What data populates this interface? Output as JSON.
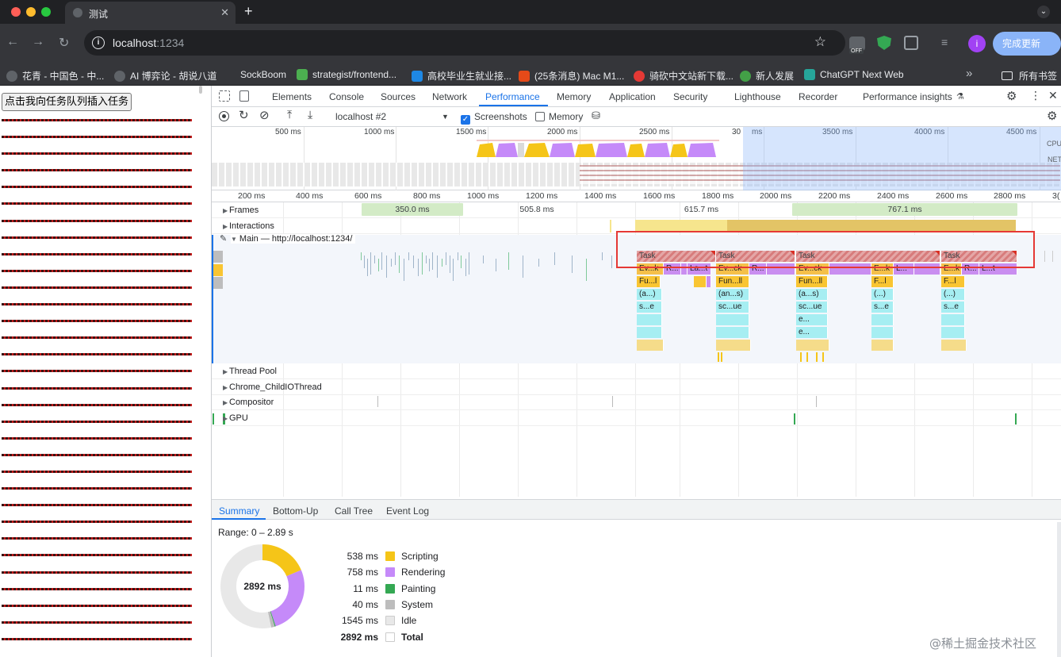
{
  "browser": {
    "tab_title": "测试",
    "url_host": "localhost",
    "url_port": ":1234",
    "update_button": "完成更新",
    "avatar_letter": "i",
    "off_badge": "OFF"
  },
  "bookmarks": [
    {
      "label": "花青 - 中国色 - 中...",
      "color": "#5f6368"
    },
    {
      "label": "AI 博弈论 - 胡说八道",
      "color": "#5f6368"
    },
    {
      "label": "SockBoom",
      "color": "#35363a"
    },
    {
      "label": "strategist/frontend...",
      "color": "#4caf50"
    },
    {
      "label": "高校毕业生就业接...",
      "color": "#1e88e5"
    },
    {
      "label": "(25条消息) Mac M1...",
      "color": "#e64a19"
    },
    {
      "label": "骑砍中文站新下载...",
      "color": "#e53935"
    },
    {
      "label": "新人发展",
      "color": "#43a047"
    },
    {
      "label": "ChatGPT Next Web",
      "color": "#26a69a"
    }
  ],
  "bookmarks_all": "所有书签",
  "page": {
    "insert_button": "点击我向任务队列插入任务"
  },
  "devtools": {
    "tabs": [
      "Elements",
      "Console",
      "Sources",
      "Network",
      "Performance",
      "Memory",
      "Application",
      "Security",
      "Lighthouse",
      "Recorder",
      "Performance insights"
    ],
    "active_tab": "Performance",
    "recording_select": "localhost #2",
    "screenshots_label": "Screenshots",
    "screenshots_checked": true,
    "memory_label": "Memory",
    "memory_checked": false,
    "overview_ticks": [
      "500 ms",
      "1000 ms",
      "1500 ms",
      "2000 ms",
      "2500 ms",
      "30",
      "ms",
      "3500 ms",
      "4000 ms",
      "4500 ms"
    ],
    "overview_cpu": "CPU",
    "overview_net": "NET",
    "ruler_ticks": [
      "200 ms",
      "400 ms",
      "600 ms",
      "800 ms",
      "1000 ms",
      "1200 ms",
      "1400 ms",
      "1600 ms",
      "1800 ms",
      "2000 ms",
      "2200 ms",
      "2400 ms",
      "2600 ms",
      "2800 ms",
      "3("
    ],
    "tracks": {
      "frames": "Frames",
      "frame_values": [
        "350.0 ms",
        "505.8 ms",
        "615.7 ms",
        "767.1 ms"
      ],
      "interactions": "Interactions",
      "main": "Main — http://localhost:1234/",
      "thread_pool": "Thread Pool",
      "io_thread": "Chrome_ChildIOThread",
      "compositor": "Compositor",
      "gpu": "GPU"
    },
    "flame": {
      "task": "Task",
      "row2": [
        "Ev...k",
        "R...",
        "La...t",
        "Ev...ck",
        "R...",
        "Ev...ck",
        "E...k",
        "L...",
        "E...k",
        "R...",
        "L...t"
      ],
      "row3": [
        "Fu...l",
        "Fun...ll",
        "Fun...ll",
        "F...l",
        "F...l"
      ],
      "row4": [
        "(a...)",
        "(an...s)",
        "(a...s)",
        "(...)",
        "(...)"
      ],
      "row5": [
        "s...e",
        "sc...ue",
        "sc...ue",
        "s...e",
        "s...e"
      ],
      "row6": [
        "e..."
      ],
      "row7": [
        "e..."
      ]
    },
    "summary_tabs": [
      "Summary",
      "Bottom-Up",
      "Call Tree",
      "Event Log"
    ],
    "range": "Range: 0 – 2.89 s",
    "total_label": "2892 ms",
    "legend": [
      {
        "value": "538 ms",
        "name": "Scripting",
        "color": "#f5c518",
        "ms": 538
      },
      {
        "value": "758 ms",
        "name": "Rendering",
        "color": "#c58af9",
        "ms": 758
      },
      {
        "value": "11 ms",
        "name": "Painting",
        "color": "#34a853",
        "ms": 11
      },
      {
        "value": "40 ms",
        "name": "System",
        "color": "#bdbdbd",
        "ms": 40
      },
      {
        "value": "1545 ms",
        "name": "Idle",
        "color": "#e8e8e8",
        "ms": 1545
      },
      {
        "value": "2892 ms",
        "name": "Total",
        "color": "#ffffff",
        "ms": 2892
      }
    ]
  },
  "watermark": "@稀土掘金技术社区"
}
